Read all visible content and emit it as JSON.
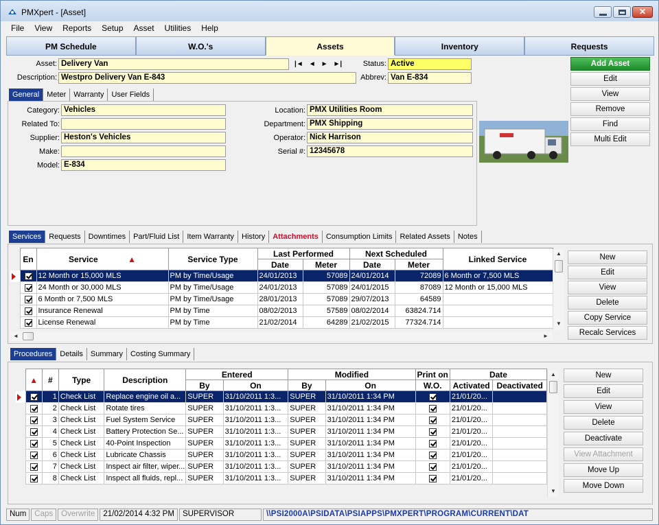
{
  "window": {
    "title": "PMXpert - [Asset]"
  },
  "menu": [
    "File",
    "View",
    "Reports",
    "Setup",
    "Asset",
    "Utilities",
    "Help"
  ],
  "nav_tabs": [
    "PM Schedule",
    "W.O.'s",
    "Assets",
    "Inventory",
    "Requests"
  ],
  "asset": {
    "asset_label": "Asset:",
    "asset": "Delivery Van",
    "description_label": "Description:",
    "description": "Westpro Delivery Van E-843",
    "status_label": "Status:",
    "status": "Active",
    "abbrev_label": "Abbrev:",
    "abbrev": "Van E-834"
  },
  "nav_arrows": [
    "|◄",
    "◄",
    "►",
    "►|"
  ],
  "info_tabs": [
    "General",
    "Meter",
    "Warranty",
    "User Fields"
  ],
  "general": {
    "category_label": "Category:",
    "category": "Vehicles",
    "related_label": "Related To:",
    "related": "",
    "supplier_label": "Supplier:",
    "supplier": "Heston's Vehicles",
    "make_label": "Make:",
    "make": "",
    "model_label": "Model:",
    "model": "E-834",
    "location_label": "Location:",
    "location": "PMX Utilities Room",
    "department_label": "Department:",
    "department": "PMX Shipping",
    "operator_label": "Operator:",
    "operator": "Nick Harrison",
    "serial_label": "Serial #:",
    "serial": "12345678"
  },
  "asset_buttons": [
    "Add Asset",
    "Edit",
    "View",
    "Remove",
    "Find",
    "Multi Edit"
  ],
  "service_tabs": [
    "Services",
    "Requests",
    "Downtimes",
    "Part/Fluid List",
    "Item Warranty",
    "History",
    "Attachments",
    "Consumption Limits",
    "Related Assets",
    "Notes"
  ],
  "services": {
    "headers": {
      "en": "En",
      "service": "Service",
      "type": "Service Type",
      "last": "Last Performed",
      "next": "Next Scheduled",
      "date": "Date",
      "meter": "Meter",
      "linked": "Linked Service"
    },
    "rows": [
      {
        "service": "12 Month or 15,000 MLS",
        "type": "PM by Time/Usage",
        "last_date": "24/01/2013",
        "last_meter": "57089",
        "next_date": "24/01/2014",
        "next_meter": "72089",
        "linked": "6 Month or 7,500 MLS"
      },
      {
        "service": "24 Month or 30,000 MLS",
        "type": "PM by Time/Usage",
        "last_date": "24/01/2013",
        "last_meter": "57089",
        "next_date": "24/01/2015",
        "next_meter": "87089",
        "linked": "12 Month or 15,000 MLS"
      },
      {
        "service": "6 Month or 7,500 MLS",
        "type": "PM by Time/Usage",
        "last_date": "28/01/2013",
        "last_meter": "57089",
        "next_date": "29/07/2013",
        "next_meter": "64589",
        "linked": ""
      },
      {
        "service": "Insurance Renewal",
        "type": "PM by Time",
        "last_date": "08/02/2013",
        "last_meter": "57589",
        "next_date": "08/02/2014",
        "next_meter": "63824.714",
        "linked": ""
      },
      {
        "service": "License Renewal",
        "type": "PM by Time",
        "last_date": "21/02/2014",
        "last_meter": "64289",
        "next_date": "21/02/2015",
        "next_meter": "77324.714",
        "linked": ""
      }
    ]
  },
  "service_buttons": [
    "New",
    "Edit",
    "View",
    "Delete",
    "Copy Service",
    "Recalc Services"
  ],
  "procedure_tabs": [
    "Procedures",
    "Details",
    "Summary",
    "Costing Summary"
  ],
  "procedures": {
    "headers": {
      "num": "#",
      "type": "Type",
      "desc": "Description",
      "entered": "Entered",
      "modified": "Modified",
      "by": "By",
      "on": "On",
      "print1": "Print on",
      "print2": "W.O.",
      "date": "Date",
      "activated": "Activated",
      "deactivated": "Deactivated"
    },
    "rows": [
      {
        "num": "1",
        "type": "Check List",
        "desc": "Replace engine oil a...",
        "eby": "SUPER",
        "eon": "31/10/2011 1:3...",
        "mby": "SUPER",
        "mon": "31/10/2011 1:34 PM",
        "act": "21/01/20..."
      },
      {
        "num": "2",
        "type": "Check List",
        "desc": "Rotate tires",
        "eby": "SUPER",
        "eon": "31/10/2011 1:3...",
        "mby": "SUPER",
        "mon": "31/10/2011 1:34 PM",
        "act": "21/01/20..."
      },
      {
        "num": "3",
        "type": "Check List",
        "desc": "Fuel System Service",
        "eby": "SUPER",
        "eon": "31/10/2011 1:3...",
        "mby": "SUPER",
        "mon": "31/10/2011 1:34 PM",
        "act": "21/01/20..."
      },
      {
        "num": "4",
        "type": "Check List",
        "desc": "Battery Protection Se...",
        "eby": "SUPER",
        "eon": "31/10/2011 1:3...",
        "mby": "SUPER",
        "mon": "31/10/2011 1:34 PM",
        "act": "21/01/20..."
      },
      {
        "num": "5",
        "type": "Check List",
        "desc": "40-Point Inspection",
        "eby": "SUPER",
        "eon": "31/10/2011 1:3...",
        "mby": "SUPER",
        "mon": "31/10/2011 1:34 PM",
        "act": "21/01/20..."
      },
      {
        "num": "6",
        "type": "Check List",
        "desc": "Lubricate Chassis",
        "eby": "SUPER",
        "eon": "31/10/2011 1:3...",
        "mby": "SUPER",
        "mon": "31/10/2011 1:34 PM",
        "act": "21/01/20..."
      },
      {
        "num": "7",
        "type": "Check List",
        "desc": "Inspect air filter, wiper...",
        "eby": "SUPER",
        "eon": "31/10/2011 1:3...",
        "mby": "SUPER",
        "mon": "31/10/2011 1:34 PM",
        "act": "21/01/20..."
      },
      {
        "num": "8",
        "type": "Check List",
        "desc": "Inspect all fluids, repl...",
        "eby": "SUPER",
        "eon": "31/10/2011 1:3...",
        "mby": "SUPER",
        "mon": "31/10/2011 1:34 PM",
        "act": "21/01/20..."
      }
    ]
  },
  "procedure_buttons": [
    "New",
    "Edit",
    "View",
    "Delete",
    "Deactivate",
    "View Attachment",
    "Move Up",
    "Move Down"
  ],
  "statusbar": {
    "num": "Num",
    "caps": "Caps",
    "overwrite": "Overwrite",
    "datetime": "21/02/2014 4:32 PM",
    "user": "SUPERVISOR",
    "path": "\\\\PSI2000A\\PSIDATA\\PSIAPPS\\PMXPERT\\PROGRAM\\CURRENT\\DAT"
  },
  "colors": {
    "selection": "#0a246a",
    "field": "#fffdd0",
    "active_tab": "#1c3f94",
    "add_button": "#1e8a2b",
    "attachments": "#c8102e"
  }
}
